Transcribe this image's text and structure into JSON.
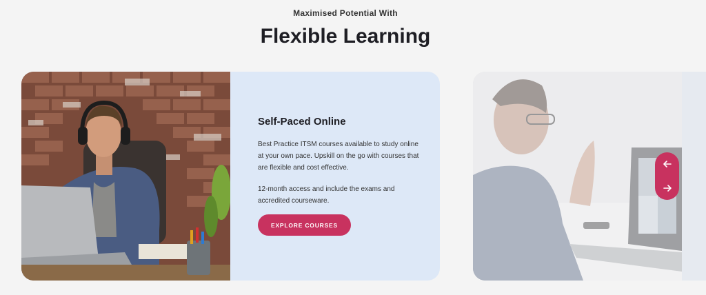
{
  "section": {
    "eyebrow": "Maximised Potential With",
    "title": "Flexible Learning"
  },
  "card": {
    "title": "Self-Paced Online",
    "paragraph1": "Best Practice ITSM courses available to study online at your own pace. Upskill on the go with courses that are flexible and cost effective.",
    "paragraph2": "12-month access and include the exams and accredited courseware.",
    "cta_label": "EXPLORE COURSES"
  },
  "carousel": {
    "prev_icon": "arrow-left-icon",
    "next_icon": "arrow-right-icon"
  },
  "colors": {
    "accent": "#c8325f",
    "card_bg": "#dde8f7",
    "page_bg": "#f4f4f4"
  }
}
